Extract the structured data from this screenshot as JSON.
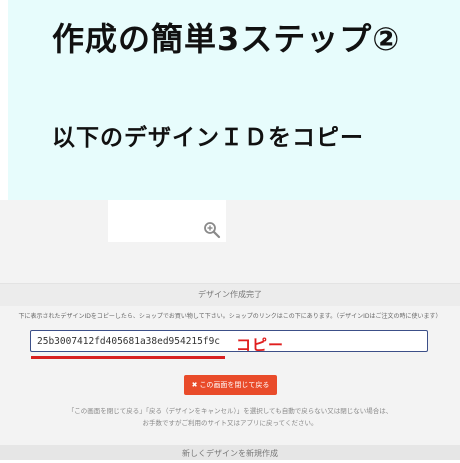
{
  "banner": {
    "title": "作成の簡単3ステップ②",
    "subtitle": "以下のデザインＩＤをコピー"
  },
  "icons": {
    "zoom": "zoom-in-icon",
    "close": "close-x-icon"
  },
  "panel": {
    "status_bar": "デザイン作成完了",
    "notice": "下に表示されたデザインIDをコピーしたら、ショップでお買い物して下さい。ショップのリンクはこの下にあります。（デザインIDはご注文の時に使います）",
    "design_id": "25b3007412fd405681a38ed954215f9c",
    "copy_note": "コピー",
    "close_button": "この画面を閉じて戻る",
    "footer_line1": "「この画面を閉じて戻る」「戻る（デザインをキャンセル）」を選択しても自動で戻らない又は閉じない場合は、",
    "footer_line2": "お手数ですがご利用のサイト又はアプリに戻ってください。",
    "new_design_bar": "新しくデザインを新規作成"
  },
  "colors": {
    "banner_bg": "#e7fcfc",
    "accent_red": "#e01e1e",
    "button_bg": "#e94b2a",
    "field_border": "#3c4f88"
  }
}
